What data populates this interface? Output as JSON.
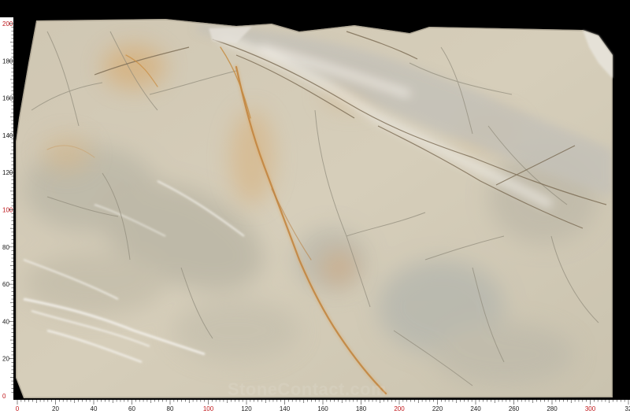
{
  "ruler": {
    "x_labels": [
      "0",
      "20",
      "40",
      "60",
      "80",
      "100",
      "120",
      "140",
      "160",
      "180",
      "200",
      "220",
      "240",
      "260",
      "280",
      "300",
      "32"
    ],
    "x_red": [
      "0",
      "100",
      "200",
      "300"
    ],
    "y_labels": [
      "200",
      "180",
      "160",
      "140",
      "120",
      "100",
      "80",
      "60",
      "40",
      "20",
      "0"
    ],
    "y_red": [
      "200",
      "100",
      "0"
    ]
  },
  "watermark": {
    "text": "StoneContact.com"
  },
  "colors": {
    "background": "#000000",
    "ruler_bg": "#ffffff",
    "ruler_red": "#c0171b",
    "stone_base": "#d2c9b5",
    "stone_gray": "#b5b4a6",
    "rust_vein": "#c98b3e"
  }
}
